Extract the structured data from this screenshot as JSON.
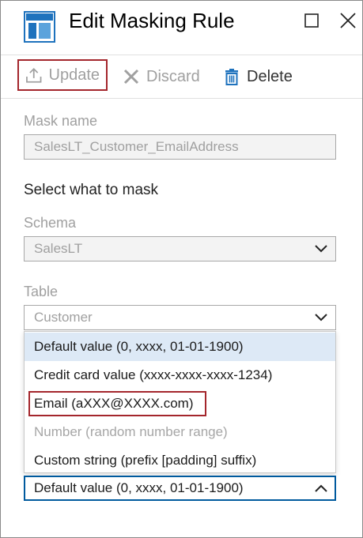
{
  "header": {
    "title": "Edit Masking Rule"
  },
  "toolbar": {
    "update_label": "Update",
    "discard_label": "Discard",
    "delete_label": "Delete"
  },
  "form": {
    "mask_name_label": "Mask name",
    "mask_name_value": "SalesLT_Customer_EmailAddress",
    "select_heading": "Select what to mask",
    "schema_label": "Schema",
    "schema_value": "SalesLT",
    "table_label": "Table",
    "table_value": "Customer",
    "masking_field_value": "Default value (0, xxxx, 01-01-1900)"
  },
  "dropdown": {
    "options": [
      {
        "label": "Default value (0, xxxx, 01-01-1900)",
        "state": "selected"
      },
      {
        "label": "Credit card value (xxxx-xxxx-xxxx-1234)",
        "state": "normal"
      },
      {
        "label": "Email (aXXX@XXXX.com)",
        "state": "highlighted"
      },
      {
        "label": "Number (random number range)",
        "state": "disabled"
      },
      {
        "label": "Custom string (prefix [padding] suffix)",
        "state": "normal"
      }
    ]
  },
  "colors": {
    "accent": "#005a9e",
    "highlight_border": "#a4262c",
    "selected_bg": "#dde9f6",
    "icon_blue": "#1e72bd"
  }
}
